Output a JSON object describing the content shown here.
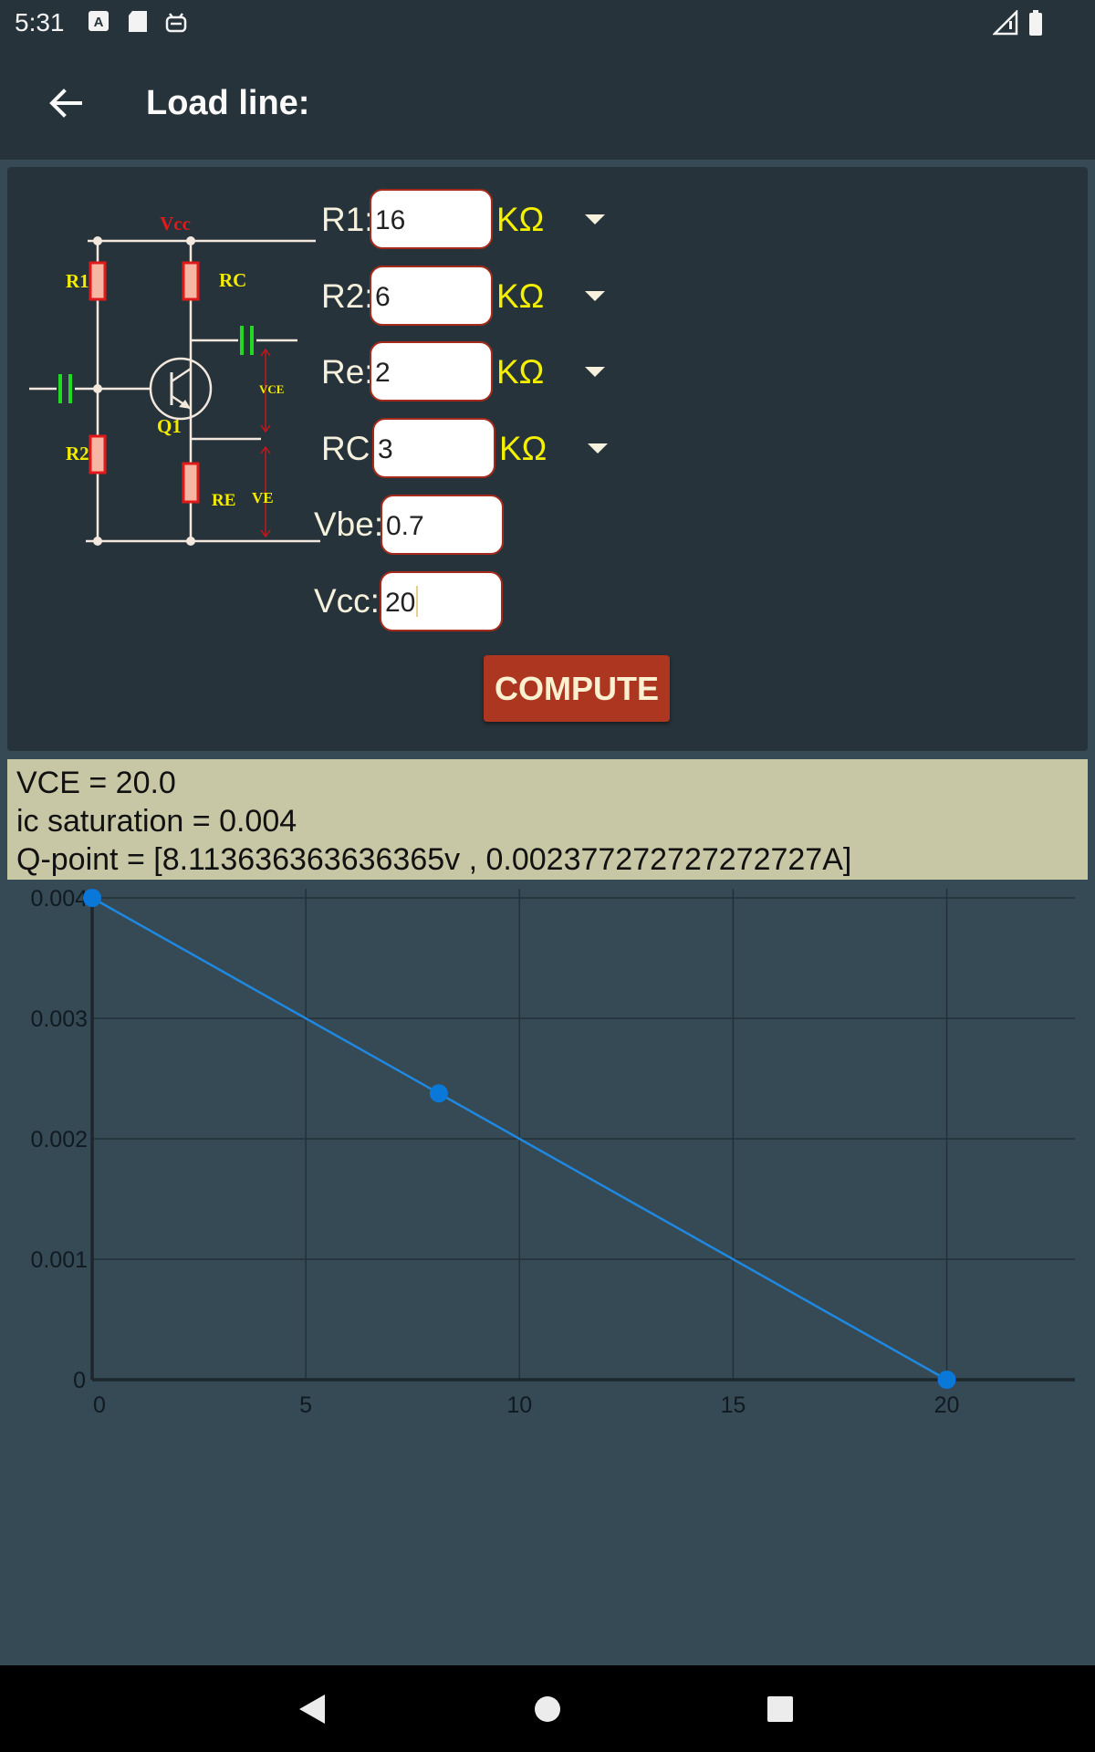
{
  "status_bar": {
    "time": "5:31"
  },
  "app_bar": {
    "title": "Load line:"
  },
  "circuit": {
    "labels": {
      "vcc": "Vcc",
      "r1": "R1",
      "rc": "RC",
      "r2": "R2",
      "re": "RE",
      "q1": "Q1",
      "vce": "VCE",
      "ve": "VE"
    }
  },
  "form": {
    "r1": {
      "label": "R1:",
      "value": "16",
      "unit": "KΩ"
    },
    "r2": {
      "label": "R2:",
      "value": "6",
      "unit": "KΩ"
    },
    "re": {
      "label": "Re:",
      "value": "2",
      "unit": "KΩ"
    },
    "rc": {
      "label": "RC:",
      "value": "3",
      "unit": "KΩ"
    },
    "vbe": {
      "label": "Vbe:",
      "value": "0.7"
    },
    "vcc": {
      "label": "Vcc:",
      "value": "20"
    },
    "compute_label": "COMPUTE"
  },
  "results": {
    "vce": "VCE = 20.0",
    "ic_sat": "ic saturation = 0.004",
    "qpoint": "Q-point = [8.113636363636365v , 0.002377272727272727A]"
  },
  "chart_data": {
    "type": "line",
    "x": [
      0,
      8.113636363636365,
      20
    ],
    "y": [
      0.004,
      0.002377272727272727,
      0
    ],
    "x_ticks": [
      "0",
      "5",
      "10",
      "15",
      "20"
    ],
    "y_ticks": [
      "0",
      "0.001",
      "0.002",
      "0.003",
      "0.004"
    ],
    "xlim": [
      0,
      23
    ],
    "ylim": [
      0,
      0.004
    ],
    "grid": true,
    "line_color": "#1f88e0",
    "point_color": "#0a78d8"
  },
  "colors": {
    "bar": "#27333a",
    "background": "#364a55",
    "accent": "#ad3621",
    "results_bg": "#c7c7a6"
  }
}
